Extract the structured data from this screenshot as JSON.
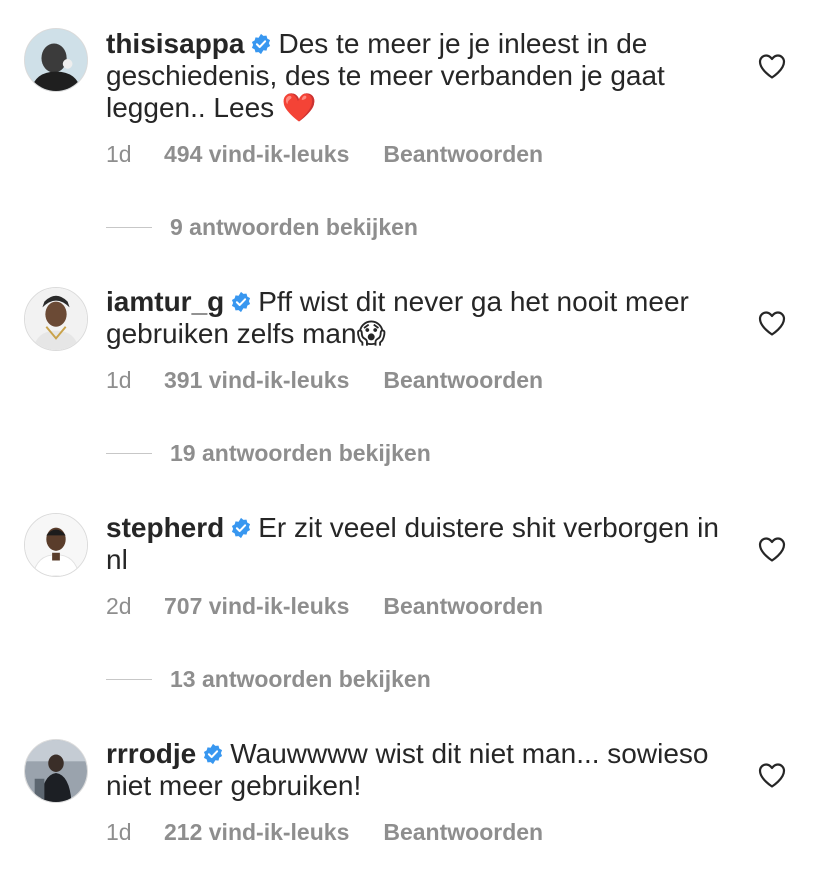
{
  "comments": [
    {
      "username": "thisisappa",
      "text": "Des te meer je je inleest in de geschiedenis, des te meer verbanden je gaat leggen.. Lees",
      "emoji": "❤️",
      "time": "1d",
      "likes": "494 vind-ik-leuks",
      "reply": "Beantwoorden",
      "view_replies": "9 antwoorden bekijken"
    },
    {
      "username": "iamtur_g",
      "text": "Pff wist dit never ga het nooit meer gebruiken zelfs man",
      "emoji": "😱",
      "time": "1d",
      "likes": "391 vind-ik-leuks",
      "reply": "Beantwoorden",
      "view_replies": "19 antwoorden bekijken"
    },
    {
      "username": "stepherd",
      "text": "Er zit veeel duistere shit verborgen in nl",
      "emoji": "",
      "time": "2d",
      "likes": "707 vind-ik-leuks",
      "reply": "Beantwoorden",
      "view_replies": "13 antwoorden bekijken"
    },
    {
      "username": "rrrodje",
      "text": "Wauwwww wist dit niet man... sowieso niet meer gebruiken!",
      "emoji": "",
      "time": "1d",
      "likes": "212 vind-ik-leuks",
      "reply": "Beantwoorden",
      "view_replies": ""
    }
  ],
  "icons": {
    "verified": "verified-badge-icon",
    "like": "heart-outline-icon"
  },
  "colors": {
    "text": "#262626",
    "secondary": "#8e8e8e",
    "verified": "#3897f0",
    "heart_emoji": "#ed4956"
  }
}
